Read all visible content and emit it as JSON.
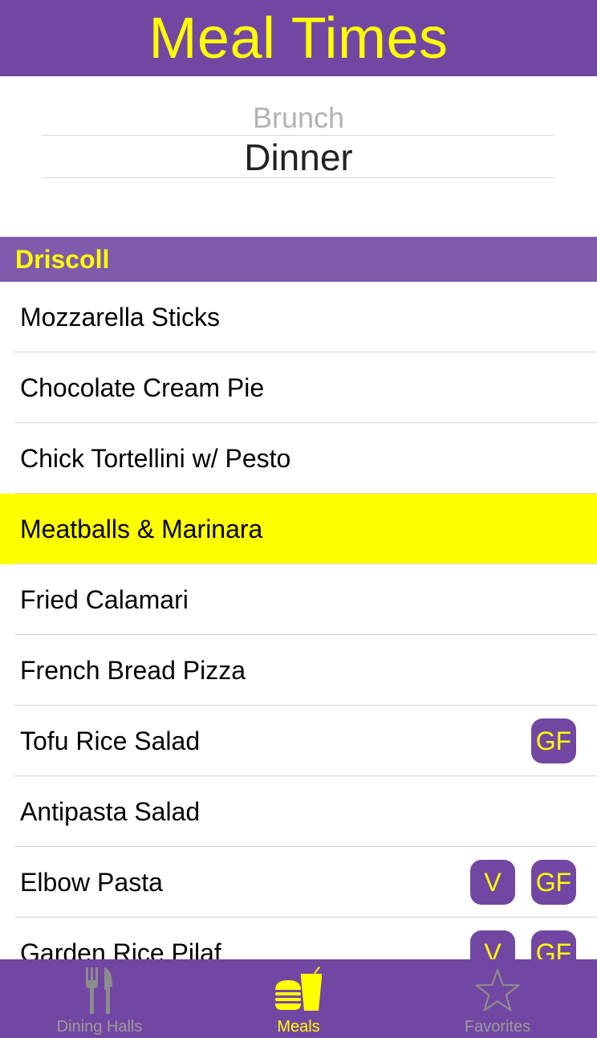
{
  "header": {
    "title": "Meal Times"
  },
  "picker": {
    "above": "Brunch",
    "selected": "Dinner"
  },
  "section": {
    "title": "Driscoll"
  },
  "items": [
    {
      "label": "Mozzarella Sticks",
      "badges": []
    },
    {
      "label": "Chocolate Cream Pie",
      "badges": []
    },
    {
      "label": "Chick Tortellini w/ Pesto",
      "badges": []
    },
    {
      "label": "Meatballs & Marinara",
      "badges": [],
      "highlighted": true
    },
    {
      "label": "Fried Calamari",
      "badges": []
    },
    {
      "label": "French Bread Pizza",
      "badges": []
    },
    {
      "label": "Tofu Rice Salad",
      "badges": [
        "GF"
      ]
    },
    {
      "label": "Antipasta Salad",
      "badges": []
    },
    {
      "label": "Elbow Pasta",
      "badges": [
        "V",
        "GF"
      ]
    },
    {
      "label": "Garden Rice Pilaf",
      "badges": [
        "V",
        "GF"
      ]
    }
  ],
  "tabs": [
    {
      "label": "Dining Halls",
      "icon": "fork-knife-icon",
      "active": false
    },
    {
      "label": "Meals",
      "icon": "burger-drink-icon",
      "active": true
    },
    {
      "label": "Favorites",
      "icon": "star-icon",
      "active": false
    }
  ],
  "colors": {
    "brand_purple": "#7247a3",
    "section_purple": "#7f5aad",
    "accent_yellow": "#ffff00",
    "inactive_gray": "#9a9a9a"
  }
}
